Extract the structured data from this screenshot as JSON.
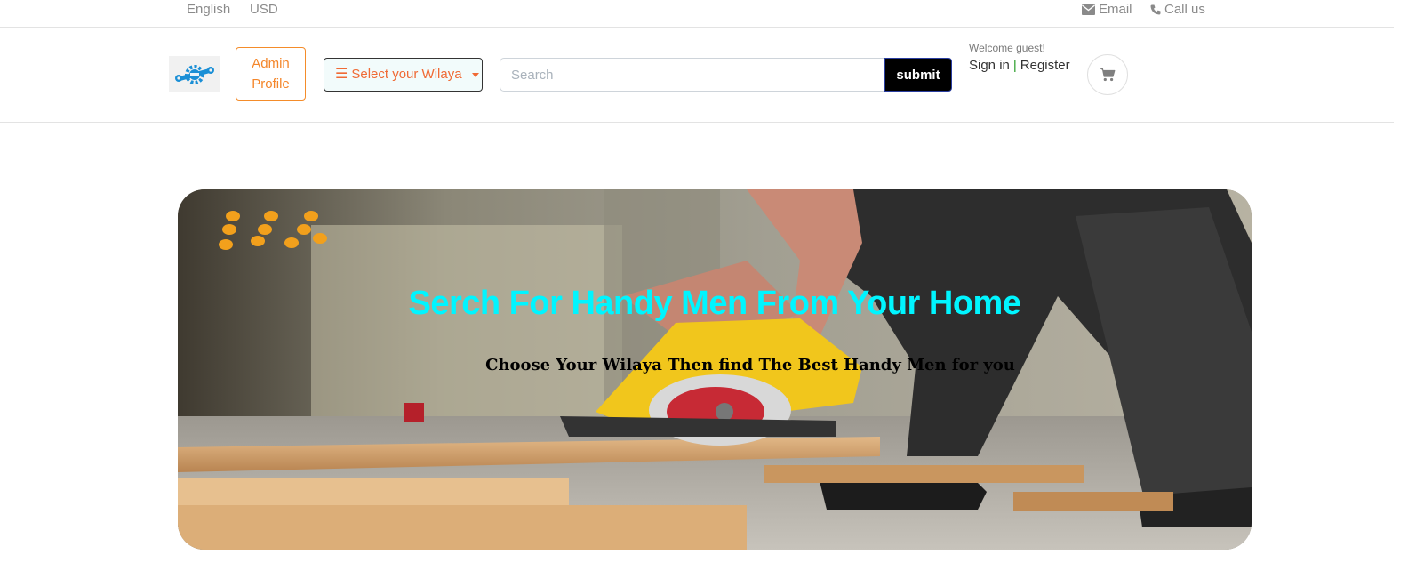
{
  "topbar": {
    "language": "English",
    "currency": "USD",
    "email_label": "Email",
    "call_label": "Call us",
    "email_icon": "envelope-icon",
    "call_icon": "phone-icon"
  },
  "header": {
    "logo_icon": "wrench-gear-logo",
    "admin_button": "Admin Profile",
    "wilaya_select": "Select your Wilaya",
    "search_placeholder": "Search",
    "search_value": "",
    "submit_label": "submit",
    "welcome": "Welcome guest!",
    "sign_in": "Sign in",
    "separator": "|",
    "register": "Register",
    "cart_icon": "shopping-cart-icon"
  },
  "hero": {
    "title": "Serch For Handy Men From Your Home",
    "subtitle": "Choose Your Wilaya Then find The Best Handy Men for you",
    "background_image": "man-cutting-wood-with-circular-saw-photo"
  },
  "colors": {
    "accent_orange": "#f4862a",
    "wilaya_text": "#f06a35",
    "hero_title": "#00f5ff",
    "submit_bg": "#000000"
  }
}
